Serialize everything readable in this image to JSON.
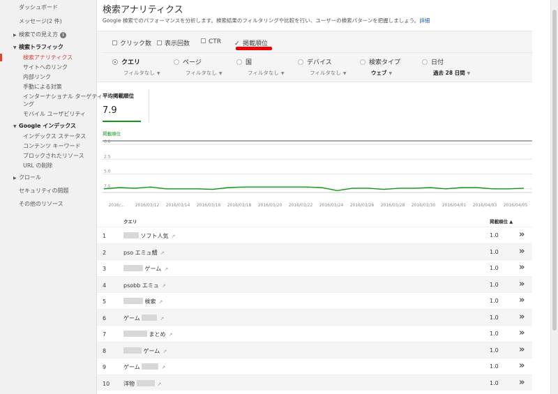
{
  "sidebar": {
    "dashboard": "ダッシュボード",
    "messages": "メッセージ(2 件)",
    "search_appearance": "検索での見え方",
    "search_traffic": "検索トラフィック",
    "search_analytics": "検索アナリティクス",
    "links_to_site": "サイトへのリンク",
    "internal_links": "内部リンク",
    "manual_actions": "手動による対策",
    "intl_targeting_1": "インターナショナル ターゲティ",
    "intl_targeting_2": "ング",
    "mobile_usability": "モバイル ユーザビリティ",
    "google_index": "Google インデックス",
    "index_status": "インデックス ステータス",
    "content_keywords": "コンテンツ キーワード",
    "blocked_resources": "ブロックされたリソース",
    "remove_urls": "URL の削除",
    "crawl": "クロール",
    "security_issues": "セキュリティの問題",
    "other_resources": "その他のリソース"
  },
  "header": {
    "title": "検索アナリティクス",
    "description": "Google 検索でのパフォーマンスを分析します。検索結果のフィルタリングや比較を行い、ユーザーの検索パターンを把握しましょう。",
    "details_link": "詳細"
  },
  "metrics": {
    "clicks": "クリック数",
    "impressions": "表示回数",
    "ctr": "CTR",
    "position": "掲載順位"
  },
  "dimensions": {
    "query": "クエリ",
    "page": "ページ",
    "country": "国",
    "device": "デバイス",
    "search_type": "検索タイプ",
    "date": "日付",
    "no_filter": "フィルタなし",
    "web": "ウェブ",
    "last_28_days": "過去 28 日間"
  },
  "stat": {
    "label": "平均掲載順位",
    "value": "7.9"
  },
  "chart_data": {
    "type": "line",
    "series": [
      {
        "name": "掲載順位",
        "values": [
          7.5,
          7.3,
          7.4,
          7.2,
          7.5,
          7.5,
          7.5,
          7.6,
          7.3,
          7.2,
          7.2,
          7.2,
          7.2,
          7.2,
          7.3,
          7.8,
          7.4,
          7.4,
          7.6,
          7.4,
          7.4,
          7.3,
          7.5,
          7.3,
          7.3,
          7.5,
          7.5,
          7.4
        ]
      }
    ],
    "ylim": [
      0,
      8
    ],
    "y_ticks": [
      "0.0",
      "2.5",
      "5.0",
      "7.5"
    ],
    "x_ticks": [
      "2016/...",
      "2016/03/12",
      "2016/03/14",
      "2016/03/16",
      "2016/03/18",
      "2016/03/20",
      "2016/03/22",
      "2016/03/24",
      "2016/03/26",
      "2016/03/28",
      "2016/03/30",
      "2016/04/01",
      "2016/04/03",
      "2016/04/05"
    ],
    "y_inverted": true,
    "grid": true,
    "color": "#109618"
  },
  "table": {
    "col_query": "クエリ",
    "col_position": "掲載順位 ▲",
    "rows": [
      {
        "num": "1",
        "pre": "",
        "blur_before": 22,
        "text": "ソフト人気",
        "blur_after": 0,
        "pos": "1.0"
      },
      {
        "num": "2",
        "pre": "",
        "blur_before": 0,
        "text": "pso エミュ鯖",
        "blur_after": 0,
        "pos": "1.0"
      },
      {
        "num": "3",
        "pre": "",
        "blur_before": 28,
        "text": "ゲーム",
        "blur_after": 0,
        "pos": "1.0"
      },
      {
        "num": "4",
        "pre": "",
        "blur_before": 0,
        "text": "psobb エミュ",
        "blur_after": 0,
        "pos": "1.0"
      },
      {
        "num": "5",
        "pre": "",
        "blur_before": 28,
        "text": "検索",
        "blur_after": 0,
        "pos": "1.0"
      },
      {
        "num": "6",
        "pre": "ゲーム",
        "blur_before": 0,
        "text": "",
        "blur_after": 22,
        "pos": "1.0"
      },
      {
        "num": "7",
        "pre": "",
        "blur_before": 34,
        "text": "まとめ",
        "blur_after": 0,
        "pos": "1.0"
      },
      {
        "num": "8",
        "pre": "",
        "blur_before": 26,
        "text": "ゲーム",
        "blur_after": 0,
        "pos": "1.0"
      },
      {
        "num": "9",
        "pre": "ゲーム",
        "blur_before": 0,
        "text": "",
        "blur_after": 24,
        "pos": "1.0"
      },
      {
        "num": "10",
        "pre": "洋物",
        "blur_before": 0,
        "text": "",
        "blur_after": 26,
        "pos": "1.0"
      }
    ]
  },
  "icons": {
    "external_link": "↗",
    "row_expand": "»",
    "checkmark": "✓",
    "info": "i",
    "caret_right": "▶",
    "caret_down": "▼",
    "dropdown": "▼"
  },
  "colors": {
    "active": "#d14836",
    "series": "#109618",
    "link": "#1a5fb4",
    "highlight": "#e00000"
  }
}
